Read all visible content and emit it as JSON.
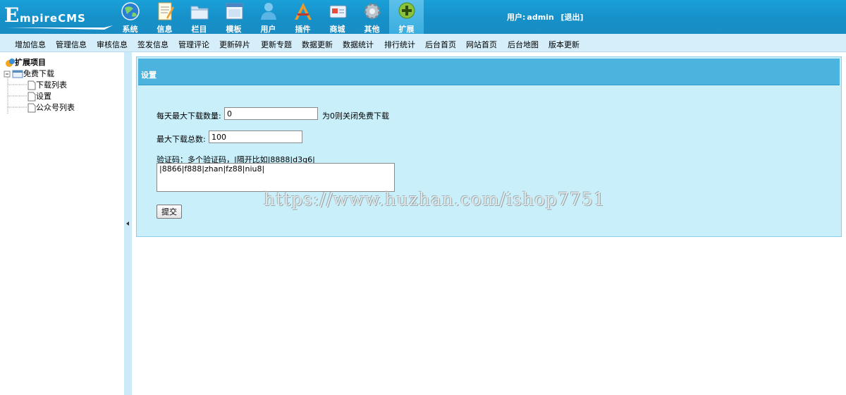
{
  "header": {
    "logo_first": "E",
    "logo_rest": "mpireCMS",
    "nav": [
      {
        "label": "系统",
        "icon": "globe-icon"
      },
      {
        "label": "信息",
        "icon": "note-icon"
      },
      {
        "label": "栏目",
        "icon": "folder-icon"
      },
      {
        "label": "模板",
        "icon": "template-window-icon"
      },
      {
        "label": "用户",
        "icon": "user-icon"
      },
      {
        "label": "插件",
        "icon": "tools-icon"
      },
      {
        "label": "商城",
        "icon": "card-icon"
      },
      {
        "label": "其他",
        "icon": "gear-icon"
      },
      {
        "label": "扩展",
        "icon": "plus-icon",
        "active": true
      }
    ],
    "user_label": "用户:",
    "username": "admin",
    "logout": "[退出]"
  },
  "menu": [
    "增加信息",
    "管理信息",
    "审核信息",
    "签发信息",
    "管理评论",
    "更新碎片",
    "更新专题",
    "数据更新",
    "数据统计",
    "排行统计",
    "后台首页",
    "网站首页",
    "后台地图",
    "版本更新"
  ],
  "tree": {
    "root": "扩展项目",
    "folder": "免费下载",
    "items": [
      "下载列表",
      "设置",
      "公众号列表"
    ]
  },
  "panel": {
    "title": "设置",
    "daily_max_label": "每天最大下载数量:",
    "daily_max_value": "0",
    "daily_max_hint": "为0则关闭免费下载",
    "total_max_label": "最大下载总数:",
    "total_max_value": "100",
    "code_label": "验证码：多个验证码，|隔开比如|8888|d3g6|",
    "code_value": "|8866|f888|zhan|fz88|niu8|",
    "submit": "提交"
  },
  "watermark": "https://www.huzhan.com/ishop7751",
  "colors": {
    "header": "#1a98d0",
    "menubar": "#d6eef9",
    "panel": "#c8effa",
    "panel_head": "#4cb3de"
  }
}
